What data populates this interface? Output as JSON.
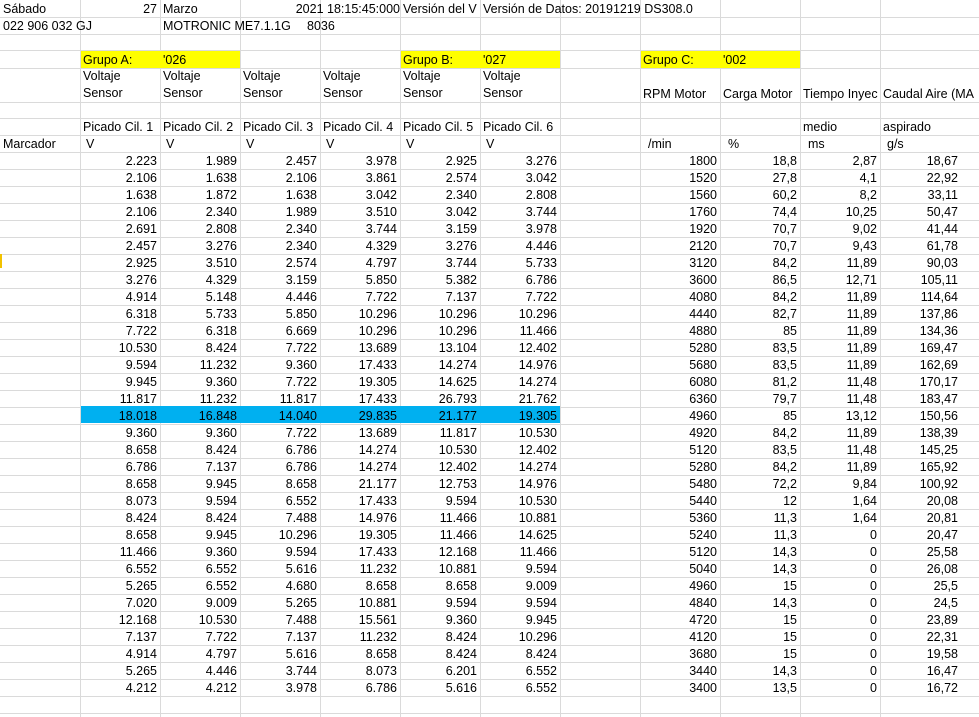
{
  "header": {
    "row1": {
      "day": "Sábado",
      "day_num": "27",
      "month": "Marzo",
      "year_time": "2021  18:15:45:000",
      "version": "Versión del V",
      "data_version": "Versión de Datos: 20191219 DS308.0"
    },
    "row2": {
      "part_number": "022 906 032 GJ",
      "ecu": "MOTRONIC ME7.1.1G",
      "code": "8036"
    }
  },
  "groups": {
    "a": {
      "label": "Grupo A:",
      "code": "'026"
    },
    "b": {
      "label": "Grupo B:",
      "code": "'027"
    },
    "c": {
      "label": "Grupo C:",
      "code": "'002"
    }
  },
  "columns": [
    {
      "line1": "Voltaje",
      "line2": "Sensor",
      "name": "Picado Cil. 1",
      "unit": "V"
    },
    {
      "line1": "Voltaje",
      "line2": "Sensor",
      "name": "Picado Cil. 2",
      "unit": "V"
    },
    {
      "line1": "Voltaje",
      "line2": "Sensor",
      "name": "Picado Cil. 3",
      "unit": "V"
    },
    {
      "line1": "Voltaje",
      "line2": "Sensor",
      "name": "Picado Cil. 4",
      "unit": "V"
    },
    {
      "line1": "Voltaje",
      "line2": "Sensor",
      "name": "Picado Cil. 5",
      "unit": "V"
    },
    {
      "line1": "Voltaje",
      "line2": "Sensor",
      "name": "Picado Cil. 6",
      "unit": "V"
    }
  ],
  "columns_c": [
    {
      "line1": "RPM Motor",
      "line2": "",
      "unit": "/min"
    },
    {
      "line1": "Carga Motor",
      "line2": "",
      "unit": "%"
    },
    {
      "line1": "Tiempo Inyec",
      "line2": "medio",
      "unit": "ms"
    },
    {
      "line1": "Caudal Aire (MA",
      "line2": "aspirado",
      "unit": "g/s"
    }
  ],
  "marker_label": "Marcador",
  "highlighted_row": 15,
  "colors": {
    "group_highlight": "#ffff00",
    "row_highlight": "#00b0f0",
    "grid": "#dadada"
  },
  "rows": [
    [
      "2.223",
      "1.989",
      "2.457",
      "3.978",
      "2.925",
      "3.276",
      "1800",
      "18,8",
      "2,87",
      "18,67"
    ],
    [
      "2.106",
      "1.638",
      "2.106",
      "3.861",
      "2.574",
      "3.042",
      "1520",
      "27,8",
      "4,1",
      "22,92"
    ],
    [
      "1.638",
      "1.872",
      "1.638",
      "3.042",
      "2.340",
      "2.808",
      "1560",
      "60,2",
      "8,2",
      "33,11"
    ],
    [
      "2.106",
      "2.340",
      "1.989",
      "3.510",
      "3.042",
      "3.744",
      "1760",
      "74,4",
      "10,25",
      "50,47"
    ],
    [
      "2.691",
      "2.808",
      "2.340",
      "3.744",
      "3.159",
      "3.978",
      "1920",
      "70,7",
      "9,02",
      "41,44"
    ],
    [
      "2.457",
      "3.276",
      "2.340",
      "4.329",
      "3.276",
      "4.446",
      "2120",
      "70,7",
      "9,43",
      "61,78"
    ],
    [
      "2.925",
      "3.510",
      "2.574",
      "4.797",
      "3.744",
      "5.733",
      "3120",
      "84,2",
      "11,89",
      "90,03"
    ],
    [
      "3.276",
      "4.329",
      "3.159",
      "5.850",
      "5.382",
      "6.786",
      "3600",
      "86,5",
      "12,71",
      "105,11"
    ],
    [
      "4.914",
      "5.148",
      "4.446",
      "7.722",
      "7.137",
      "7.722",
      "4080",
      "84,2",
      "11,89",
      "114,64"
    ],
    [
      "6.318",
      "5.733",
      "5.850",
      "10.296",
      "10.296",
      "10.296",
      "4440",
      "82,7",
      "11,89",
      "137,86"
    ],
    [
      "7.722",
      "6.318",
      "6.669",
      "10.296",
      "10.296",
      "11.466",
      "4880",
      "85",
      "11,89",
      "134,36"
    ],
    [
      "10.530",
      "8.424",
      "7.722",
      "13.689",
      "13.104",
      "12.402",
      "5280",
      "83,5",
      "11,89",
      "169,47"
    ],
    [
      "9.594",
      "11.232",
      "9.360",
      "17.433",
      "14.274",
      "14.976",
      "5680",
      "83,5",
      "11,89",
      "162,69"
    ],
    [
      "9.945",
      "9.360",
      "7.722",
      "19.305",
      "14.625",
      "14.274",
      "6080",
      "81,2",
      "11,48",
      "170,17"
    ],
    [
      "11.817",
      "11.232",
      "11.817",
      "17.433",
      "26.793",
      "21.762",
      "6360",
      "79,7",
      "11,48",
      "183,47"
    ],
    [
      "18.018",
      "16.848",
      "14.040",
      "29.835",
      "21.177",
      "19.305",
      "4960",
      "85",
      "13,12",
      "150,56"
    ],
    [
      "9.360",
      "9.360",
      "7.722",
      "13.689",
      "11.817",
      "10.530",
      "4920",
      "84,2",
      "11,89",
      "138,39"
    ],
    [
      "8.658",
      "8.424",
      "6.786",
      "14.274",
      "10.530",
      "12.402",
      "5120",
      "83,5",
      "11,48",
      "145,25"
    ],
    [
      "6.786",
      "7.137",
      "6.786",
      "14.274",
      "12.402",
      "14.274",
      "5280",
      "84,2",
      "11,89",
      "165,92"
    ],
    [
      "8.658",
      "9.945",
      "8.658",
      "21.177",
      "12.753",
      "14.976",
      "5480",
      "72,2",
      "9,84",
      "100,92"
    ],
    [
      "8.073",
      "9.594",
      "6.552",
      "17.433",
      "9.594",
      "10.530",
      "5440",
      "12",
      "1,64",
      "20,08"
    ],
    [
      "8.424",
      "8.424",
      "7.488",
      "14.976",
      "11.466",
      "10.881",
      "5360",
      "11,3",
      "1,64",
      "20,81"
    ],
    [
      "8.658",
      "9.945",
      "10.296",
      "19.305",
      "11.466",
      "14.625",
      "5240",
      "11,3",
      "0",
      "20,47"
    ],
    [
      "11.466",
      "9.360",
      "9.594",
      "17.433",
      "12.168",
      "11.466",
      "5120",
      "14,3",
      "0",
      "25,58"
    ],
    [
      "6.552",
      "6.552",
      "5.616",
      "11.232",
      "10.881",
      "9.594",
      "5040",
      "14,3",
      "0",
      "26,08"
    ],
    [
      "5.265",
      "6.552",
      "4.680",
      "8.658",
      "8.658",
      "9.009",
      "4960",
      "15",
      "0",
      "25,5"
    ],
    [
      "7.020",
      "9.009",
      "5.265",
      "10.881",
      "9.594",
      "9.594",
      "4840",
      "14,3",
      "0",
      "24,5"
    ],
    [
      "12.168",
      "10.530",
      "7.488",
      "15.561",
      "9.360",
      "9.945",
      "4720",
      "15",
      "0",
      "23,89"
    ],
    [
      "7.137",
      "7.722",
      "7.137",
      "11.232",
      "8.424",
      "10.296",
      "4120",
      "15",
      "0",
      "22,31"
    ],
    [
      "4.914",
      "4.797",
      "5.616",
      "8.658",
      "8.424",
      "8.424",
      "3680",
      "15",
      "0",
      "19,58"
    ],
    [
      "5.265",
      "4.446",
      "3.744",
      "8.073",
      "6.201",
      "6.552",
      "3440",
      "14,3",
      "0",
      "16,47"
    ],
    [
      "4.212",
      "4.212",
      "3.978",
      "6.786",
      "5.616",
      "6.552",
      "3400",
      "13,5",
      "0",
      "16,72"
    ]
  ]
}
